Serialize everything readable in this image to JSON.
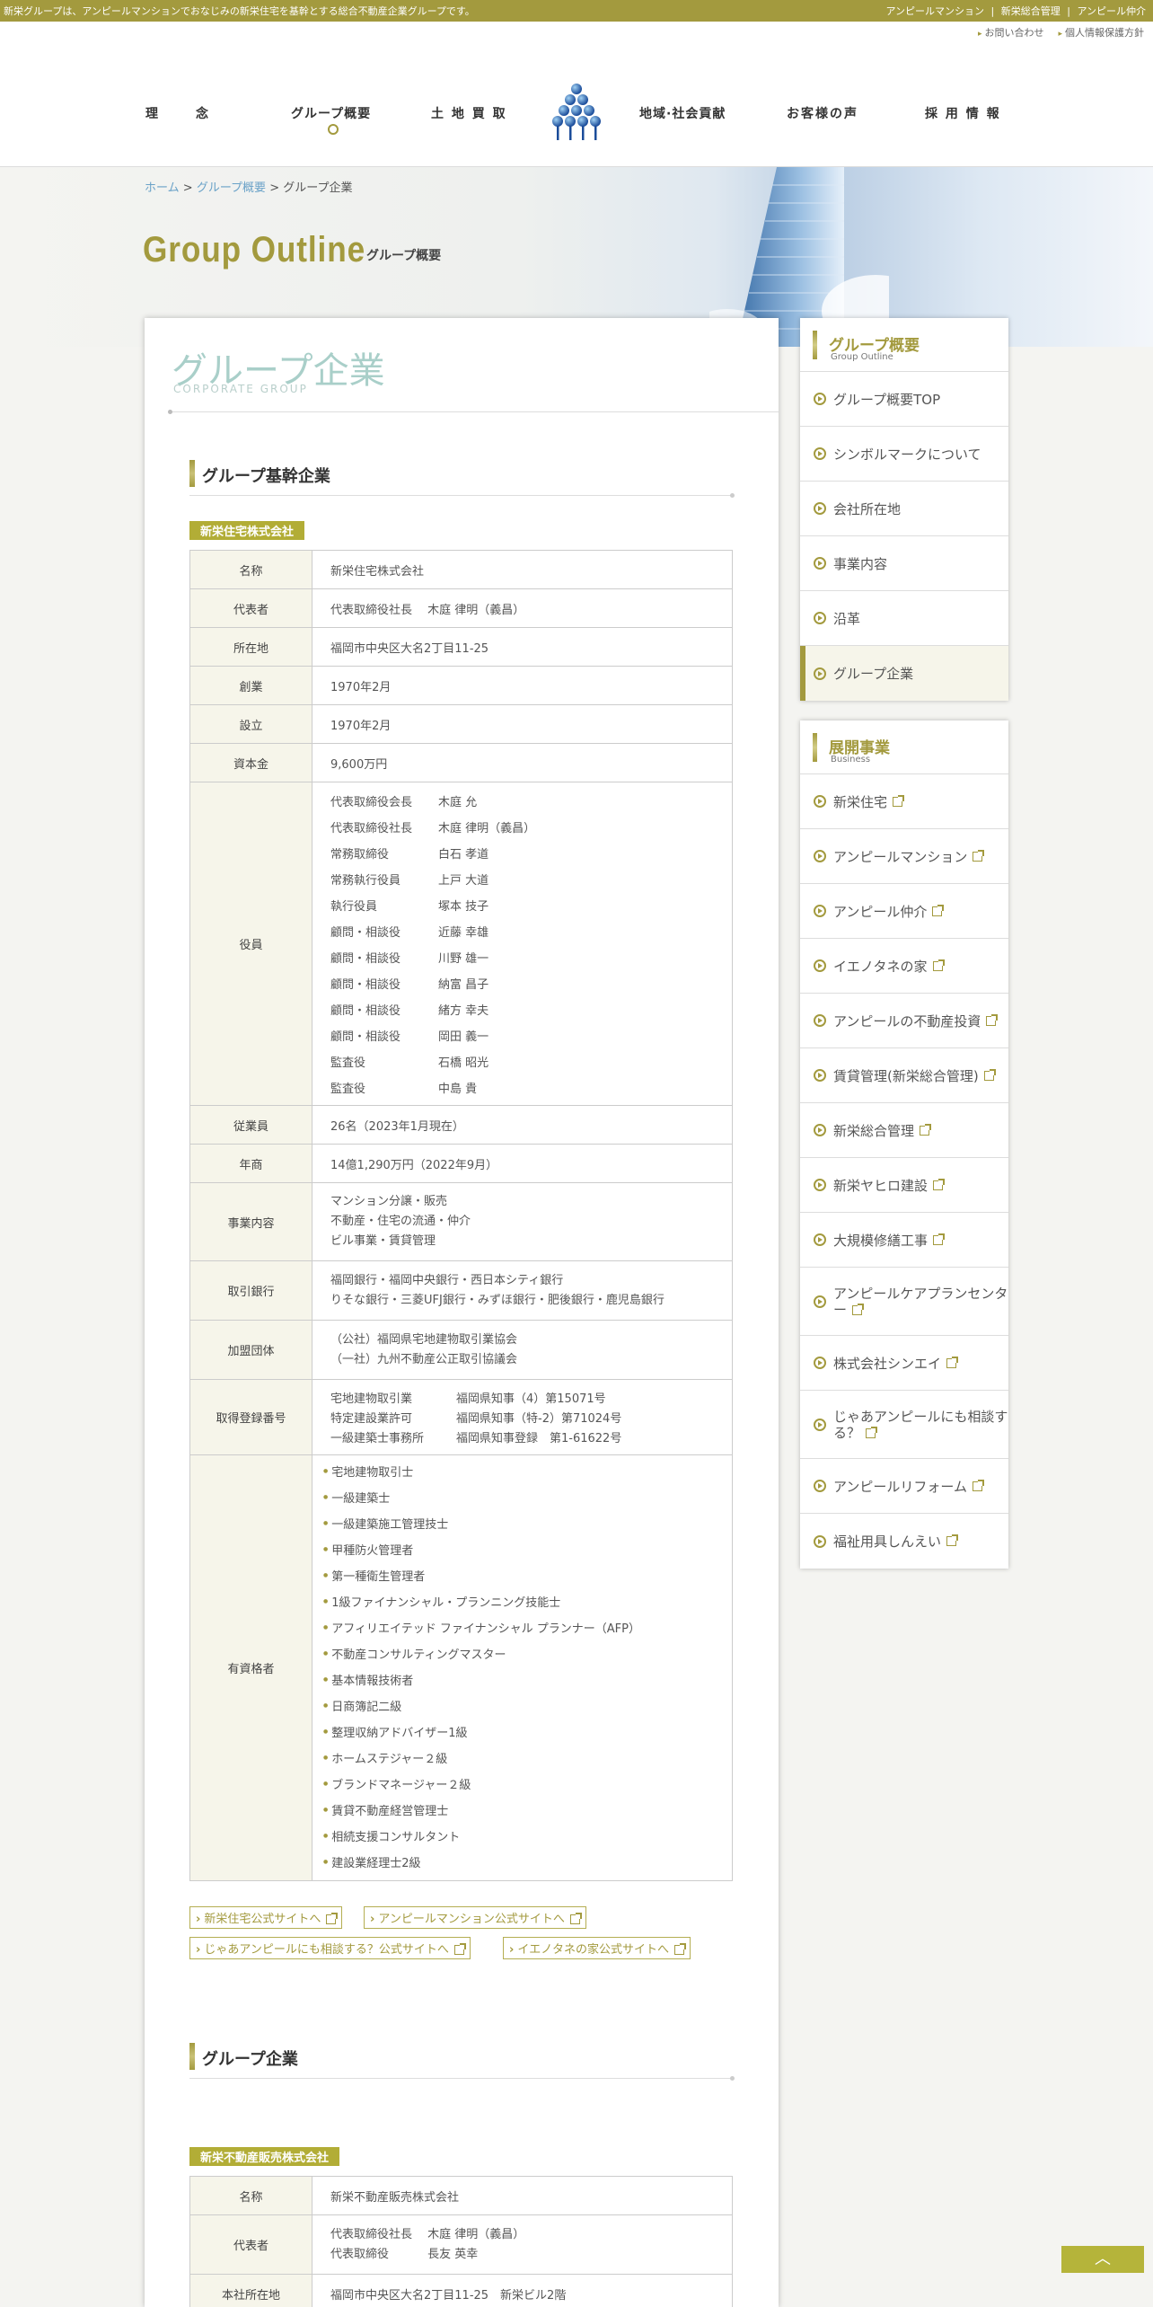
{
  "topbar": {
    "tagline": "新栄グループは、アンピールマンションでおなじみの新栄住宅を基幹とする総合不動産企業グループです。",
    "links": [
      "アンピールマンション",
      "|",
      "新栄総合管理",
      "|",
      "アンピール仲介"
    ]
  },
  "utility": {
    "contact": "お問い合わせ",
    "privacy": "個人情報保護方針"
  },
  "nav": {
    "philosophy": "理　念",
    "outline": "グループ概要",
    "land": "土 地 買 取",
    "community": "地域·社会貢献",
    "voice": "お客様の声",
    "recruit": "採 用 情 報"
  },
  "breadcrumb": {
    "home": "ホーム",
    "sep": ">",
    "outline": "グループ概要",
    "current": "グループ企業"
  },
  "hero": {
    "title": "Group Outline",
    "subtitle": "グループ概要"
  },
  "page": {
    "title": "グループ企業",
    "title_en": "CORPORATE GROUP"
  },
  "core": {
    "heading": "グループ基幹企業",
    "company_label": "新栄住宅株式会社",
    "rows": {
      "name_k": "名称",
      "name_v": "新栄住宅株式会社",
      "rep_k": "代表者",
      "rep_v": "代表取締役社長　 木庭 律明（義昌）",
      "addr_k": "所在地",
      "addr_v": "福岡市中央区大名2丁目11-25",
      "found_k": "創業",
      "found_v": "1970年2月",
      "est_k": "設立",
      "est_v": "1970年2月",
      "cap_k": "資本金",
      "cap_v": "9,600万円",
      "officers_k": "役員",
      "staff_k": "従業員",
      "staff_v": "26名（2023年1月現在）",
      "sales_k": "年商",
      "sales_v": "14億1,290万円（2022年9月）",
      "biz_k": "事業内容",
      "bank_k": "取引銀行",
      "assoc_k": "加盟団体",
      "lic_k": "取得登録番号",
      "qual_k": "有資格者"
    },
    "officers": [
      {
        "role": "代表取締役会長",
        "name": "木庭 允"
      },
      {
        "role": "代表取締役社長",
        "name": "木庭 律明（義昌）"
      },
      {
        "role": "常務取締役",
        "name": "白石 孝道"
      },
      {
        "role": "常務執行役員",
        "name": "上戸 大道"
      },
      {
        "role": "執行役員",
        "name": "塚本 技子"
      },
      {
        "role": "顧問・相談役",
        "name": "近藤 幸雄"
      },
      {
        "role": "顧問・相談役",
        "name": "川野 雄一"
      },
      {
        "role": "顧問・相談役",
        "name": "納富 昌子"
      },
      {
        "role": "顧問・相談役",
        "name": "緒方 幸夫"
      },
      {
        "role": "顧問・相談役",
        "name": "岡田 義一"
      },
      {
        "role": "監査役",
        "name": "石橋 昭光"
      },
      {
        "role": "監査役",
        "name": "中島 貴"
      }
    ],
    "biz": [
      "マンション分譲・販売",
      "不動産・住宅の流通・仲介",
      "ビル事業・賃貸管理"
    ],
    "banks": [
      "福岡銀行・福岡中央銀行・西日本シティ銀行",
      "りそな銀行・三菱UFJ銀行・みずほ銀行・肥後銀行・鹿児島銀行"
    ],
    "assoc": [
      "（公社）福岡県宅地建物取引業協会",
      "（一社）九州不動産公正取引協議会"
    ],
    "licenses": [
      {
        "k": "宅地建物取引業",
        "v": "福岡県知事（4）第15071号"
      },
      {
        "k": "特定建設業許可",
        "v": "福岡県知事（特-2）第71024号"
      },
      {
        "k": "一級建築士事務所",
        "v": "福岡県知事登録　第1-61622号"
      }
    ],
    "qualified": [
      "宅地建物取引士",
      "一級建築士",
      "一級建築施工管理技士",
      "甲種防火管理者",
      "第一種衛生管理者",
      "1級ファイナンシャル・プランニング技能士",
      "アフィリエイテッド ファイナンシャル プランナー（AFP）",
      "不動産コンサルティングマスター",
      "基本情報技術者",
      "日商簿記二級",
      "整理収納アドバイザー1級",
      "ホームステジャー２級",
      "ブランドマネージャー２級",
      "賃貸不動産経営管理士",
      "相続支援コンサルタント",
      "建設業経理士2級"
    ],
    "links": [
      "新栄住宅公式サイトへ",
      "アンピールマンション公式サイトへ",
      "じゃあアンピールにも相談する？公式サイトへ",
      "イエノタネの家公式サイトへ"
    ]
  },
  "group": {
    "heading": "グループ企業",
    "company_label": "新栄不動産販売株式会社",
    "name_k": "名称",
    "name_v": "新栄不動産販売株式会社",
    "rep_k": "代表者",
    "rep_v1": "代表取締役社長　 木庭 律明（義昌）",
    "rep_v2": "代表取締役　　　 長友 英幸",
    "addr_k": "本社所在地",
    "addr_v": "福岡市中央区大名2丁目11-25　新栄ビル2階"
  },
  "sidebar": {
    "outline_head": "グループ概要",
    "outline_head_en": "Group Outline",
    "outline_items": [
      "グループ概要TOP",
      "シンボルマークについて",
      "会社所在地",
      "事業内容",
      "沿革",
      "グループ企業"
    ],
    "biz_head": "展開事業",
    "biz_head_en": "Business",
    "biz_items": [
      "新栄住宅",
      "アンピールマンション",
      "アンピール仲介",
      "イエノタネの家",
      "アンピールの不動産投資",
      "賃貸管理(新栄総合管理)",
      "新栄総合管理",
      "新栄ヤヒロ建設",
      "大規模修繕工事",
      "アンピールケアプランセンター",
      "株式会社シンエイ",
      "じゃあアンピールにも相談する？",
      "アンピールリフォーム",
      "福祉用具しんえい"
    ]
  },
  "totop": "︿",
  "colors": {
    "accent": "#a39a3e",
    "label_bg": "#b2ad36",
    "table_head": "#f6f5ea",
    "title_teal": "#a9cfc9"
  }
}
